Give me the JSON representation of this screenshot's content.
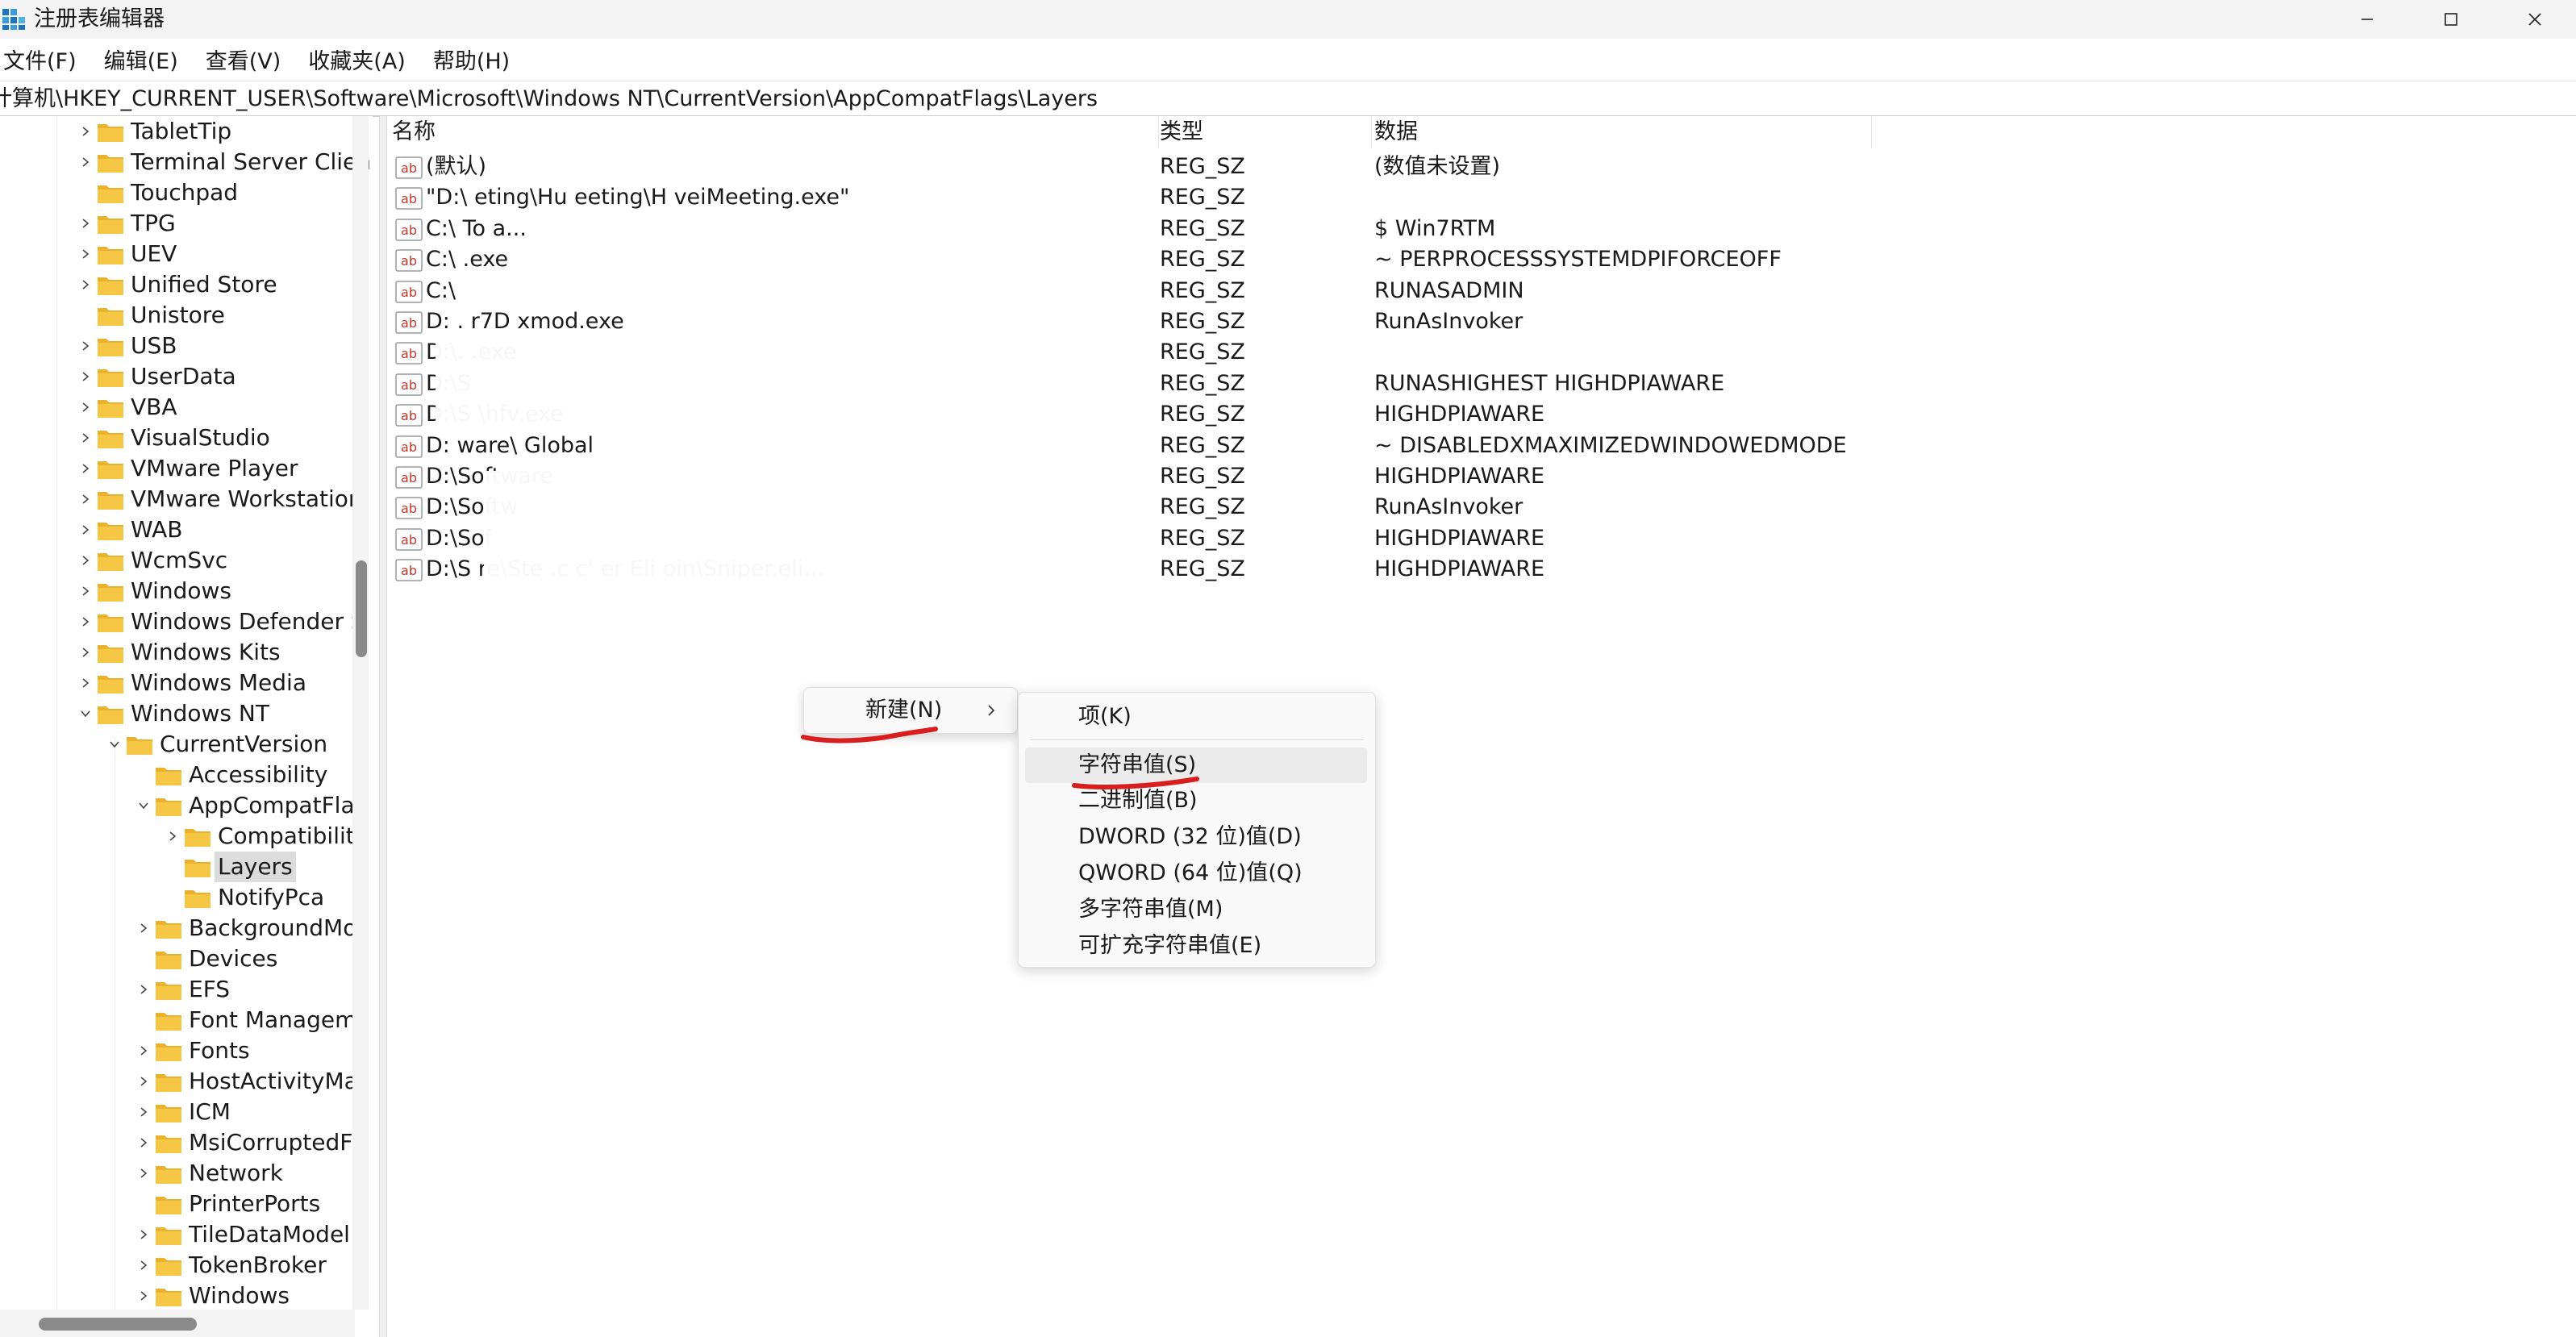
{
  "window": {
    "title": "注册表编辑器",
    "minimize_icon": "minimize-icon",
    "maximize_icon": "maximize-icon",
    "close_icon": "close-icon"
  },
  "menu": [
    "文件(F)",
    "编辑(E)",
    "查看(V)",
    "收藏夹(A)",
    "帮助(H)"
  ],
  "address": "计算机\\HKEY_CURRENT_USER\\Software\\Microsoft\\Windows NT\\CurrentVersion\\AppCompatFlags\\Layers",
  "tree": [
    {
      "label": "TabletTip",
      "level": 1,
      "chevron": "right"
    },
    {
      "label": "Terminal Server Clien",
      "level": 1,
      "chevron": "right"
    },
    {
      "label": "Touchpad",
      "level": 1,
      "chevron": "none"
    },
    {
      "label": "TPG",
      "level": 1,
      "chevron": "right"
    },
    {
      "label": "UEV",
      "level": 1,
      "chevron": "right"
    },
    {
      "label": "Unified Store",
      "level": 1,
      "chevron": "right"
    },
    {
      "label": "Unistore",
      "level": 1,
      "chevron": "none"
    },
    {
      "label": "USB",
      "level": 1,
      "chevron": "right"
    },
    {
      "label": "UserData",
      "level": 1,
      "chevron": "right"
    },
    {
      "label": "VBA",
      "level": 1,
      "chevron": "right"
    },
    {
      "label": "VisualStudio",
      "level": 1,
      "chevron": "right"
    },
    {
      "label": "VMware Player",
      "level": 1,
      "chevron": "right"
    },
    {
      "label": "VMware Workstation",
      "level": 1,
      "chevron": "right"
    },
    {
      "label": "WAB",
      "level": 1,
      "chevron": "right"
    },
    {
      "label": "WcmSvc",
      "level": 1,
      "chevron": "right"
    },
    {
      "label": "Windows",
      "level": 1,
      "chevron": "right"
    },
    {
      "label": "Windows Defender S",
      "level": 1,
      "chevron": "right"
    },
    {
      "label": "Windows Kits",
      "level": 1,
      "chevron": "right"
    },
    {
      "label": "Windows Media",
      "level": 1,
      "chevron": "right"
    },
    {
      "label": "Windows NT",
      "level": 1,
      "chevron": "down"
    },
    {
      "label": "CurrentVersion",
      "level": 2,
      "chevron": "down"
    },
    {
      "label": "Accessibility",
      "level": 3,
      "chevron": "none"
    },
    {
      "label": "AppCompatFlag",
      "level": 3,
      "chevron": "down"
    },
    {
      "label": "Compatibility",
      "level": 4,
      "chevron": "right"
    },
    {
      "label": "Layers",
      "level": 4,
      "chevron": "none",
      "selected": true
    },
    {
      "label": "NotifyPca",
      "level": 4,
      "chevron": "none"
    },
    {
      "label": "BackgroundMo",
      "level": 3,
      "chevron": "right"
    },
    {
      "label": "Devices",
      "level": 3,
      "chevron": "none"
    },
    {
      "label": "EFS",
      "level": 3,
      "chevron": "right"
    },
    {
      "label": "Font Managem",
      "level": 3,
      "chevron": "none"
    },
    {
      "label": "Fonts",
      "level": 3,
      "chevron": "right"
    },
    {
      "label": "HostActivityMa",
      "level": 3,
      "chevron": "right"
    },
    {
      "label": "ICM",
      "level": 3,
      "chevron": "right"
    },
    {
      "label": "MsiCorruptedFi",
      "level": 3,
      "chevron": "right"
    },
    {
      "label": "Network",
      "level": 3,
      "chevron": "right"
    },
    {
      "label": "PrinterPorts",
      "level": 3,
      "chevron": "none"
    },
    {
      "label": "TileDataModel",
      "level": 3,
      "chevron": "right"
    },
    {
      "label": "TokenBroker",
      "level": 3,
      "chevron": "right"
    },
    {
      "label": "Windows",
      "level": 3,
      "chevron": "right"
    }
  ],
  "columns": {
    "name": "名称",
    "type": "类型",
    "data": "数据"
  },
  "values": [
    {
      "name": "(默认)",
      "type": "REG_SZ",
      "data": "(数值未设置)"
    },
    {
      "name": "\"D:\\                                   eting\\Hu            eeting\\H         veiMeeting.exe\"",
      "type": "REG_SZ",
      "data": ""
    },
    {
      "name": "C:\\                                                                    To              a...",
      "type": "REG_SZ",
      "data": "$ Win7RTM"
    },
    {
      "name": "C:\\                                                                                      .exe",
      "type": "REG_SZ",
      "data": "~ PERPROCESSSYSTEMDPIFORCEOFF"
    },
    {
      "name": "C:\\",
      "type": "REG_SZ",
      "data": "RUNASADMIN"
    },
    {
      "name": "D:                                                     . r7D                      xmod.exe",
      "type": "REG_SZ",
      "data": "RunAsInvoker"
    },
    {
      "name": "D:\\.                                                                           .exe",
      "type": "REG_SZ",
      "data": ""
    },
    {
      "name": "D:\\S",
      "type": "REG_SZ",
      "data": "RUNASHIGHEST HIGHDPIAWARE"
    },
    {
      "name": "D:\\S                                                                        \\hfv.exe",
      "type": "REG_SZ",
      "data": "HIGHDPIAWARE"
    },
    {
      "name": "D:        ware\\                                                            Global",
      "type": "REG_SZ",
      "data": "~ DISABLEDXMAXIMIZEDWINDOWEDMODE"
    },
    {
      "name": "D:\\Software",
      "type": "REG_SZ",
      "data": "HIGHDPIAWARE"
    },
    {
      "name": "D:\\Softw",
      "type": "REG_SZ",
      "data": "RunAsInvoker"
    },
    {
      "name": "D:\\Sof",
      "type": "REG_SZ",
      "data": "HIGHDPIAWARE"
    },
    {
      "name": "D:\\S          re\\Ste                   .c      c'      er Eli          oin\\Sniper.eli...",
      "type": "REG_SZ",
      "data": "HIGHDPIAWARE"
    }
  ],
  "context_menu": {
    "new_label": "新建(N)",
    "chevron_icon": "chevron-right-icon"
  },
  "submenu": {
    "key": "项(K)",
    "items": [
      "字符串值(S)",
      "二进制值(B)",
      "DWORD (32 位)值(D)",
      "QWORD (64 位)值(Q)",
      "多字符串值(M)",
      "可扩充字符串值(E)"
    ],
    "hovered_index": 0
  },
  "colors": {
    "folder": "#f5c744",
    "annotation": "#d81e1e",
    "value_icon": "#c0392b"
  }
}
